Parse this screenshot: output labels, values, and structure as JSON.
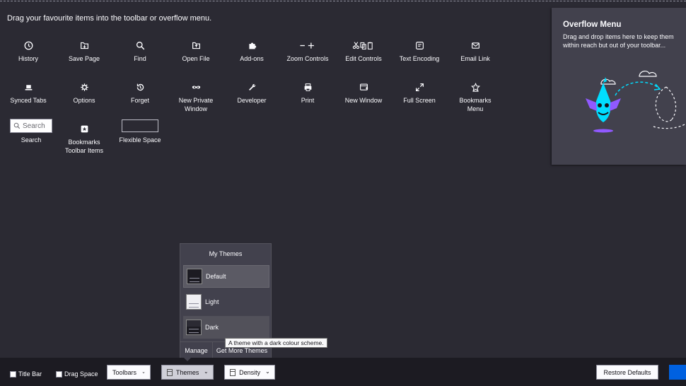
{
  "instructions": "Drag your favourite items into the toolbar or overflow menu.",
  "palette": {
    "row1": [
      {
        "label": "History",
        "icon": "clock-icon"
      },
      {
        "label": "Save Page",
        "icon": "save-page-icon"
      },
      {
        "label": "Find",
        "icon": "magnifier-icon"
      },
      {
        "label": "Open File",
        "icon": "folder-icon"
      },
      {
        "label": "Add-ons",
        "icon": "puzzle-icon"
      },
      {
        "label": "Zoom Controls",
        "icon": "zoom-icon"
      },
      {
        "label": "Edit Controls",
        "icon": "scissors-icon"
      },
      {
        "label": "Text Encoding",
        "icon": "encoding-icon"
      },
      {
        "label": "Email Link",
        "icon": "envelope-icon"
      }
    ],
    "row2": [
      {
        "label": "Synced Tabs",
        "icon": "laptop-icon"
      },
      {
        "label": "Options",
        "icon": "gear-icon"
      },
      {
        "label": "Forget",
        "icon": "forget-icon"
      },
      {
        "label": "New Private\nWindow",
        "icon": "mask-icon"
      },
      {
        "label": "Developer",
        "icon": "wrench-icon"
      },
      {
        "label": "Print",
        "icon": "printer-icon"
      },
      {
        "label": "New Window",
        "icon": "new-window-icon"
      },
      {
        "label": "Full Screen",
        "icon": "expand-icon"
      },
      {
        "label": "Bookmarks\nMenu",
        "icon": "star-icon"
      }
    ],
    "row3": {
      "search_placeholder": "Search",
      "search_label": "Search",
      "bookmarks_toolbar_label": "Bookmarks\nToolbar Items",
      "flexible_space_label": "Flexible Space"
    }
  },
  "overflow": {
    "title": "Overflow Menu",
    "description": "Drag and drop items here to keep them within reach but out of your toolbar..."
  },
  "themes_panel": {
    "title": "My Themes",
    "themes": [
      {
        "label": "Default"
      },
      {
        "label": "Light"
      },
      {
        "label": "Dark"
      }
    ],
    "manage_label": "Manage",
    "get_more_label": "Get More Themes",
    "tooltip": "A theme with a dark colour scheme."
  },
  "bottom_bar": {
    "title_bar_label": "Title Bar",
    "drag_space_label": "Drag Space",
    "toolbars_label": "Toolbars",
    "themes_label": "Themes",
    "density_label": "Density",
    "restore_label": "Restore Defaults"
  },
  "colors": {
    "background": "#2b2a33",
    "panel": "#42414d",
    "accent": "#0061e0",
    "illustration_cyan": "#00ddff",
    "illustration_purple": "#9059ff"
  }
}
